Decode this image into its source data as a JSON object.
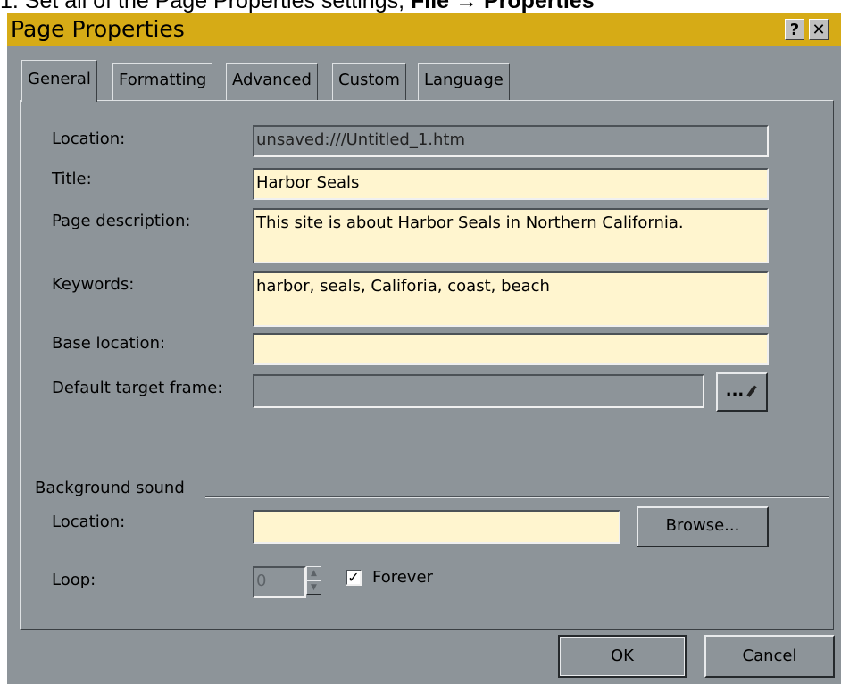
{
  "caption": {
    "prefix": "1.  Set all of the Page Properties settings, ",
    "menu_path": "File → Properties"
  },
  "window": {
    "title": "Page Properties",
    "help_button": "?",
    "close_button": "✕"
  },
  "tabs": [
    {
      "label": "General",
      "active": true
    },
    {
      "label": "Formatting",
      "active": false
    },
    {
      "label": "Advanced",
      "active": false
    },
    {
      "label": "Custom",
      "active": false
    },
    {
      "label": "Language",
      "active": false
    }
  ],
  "general": {
    "location_label": "Location:",
    "location_value": "unsaved:///Untitled_1.htm",
    "title_label": "Title:",
    "title_value": "Harbor Seals",
    "description_label": "Page description:",
    "description_value": "This site is about Harbor Seals in Northern California.",
    "keywords_label": "Keywords:",
    "keywords_value": "harbor, seals, Califoria, coast, beach",
    "base_label": "Base location:",
    "base_value": "",
    "target_label": "Default target frame:",
    "target_value": "",
    "target_button": "...",
    "target_button_icon": "pencil-icon"
  },
  "background_sound": {
    "group_label": "Background sound",
    "location_label": "Location:",
    "location_value": "",
    "browse_button": "Browse...",
    "loop_label": "Loop:",
    "loop_value": "0",
    "spin_up": "▲",
    "spin_down": "▼",
    "forever_checked": true,
    "forever_mark": "✓",
    "forever_label": "Forever"
  },
  "footer": {
    "ok_button": "OK",
    "cancel_button": "Cancel"
  },
  "colors": {
    "titlebar": "#d6ab16",
    "dialog_bg": "#8d9499",
    "field_bg": "#fff5cf"
  }
}
